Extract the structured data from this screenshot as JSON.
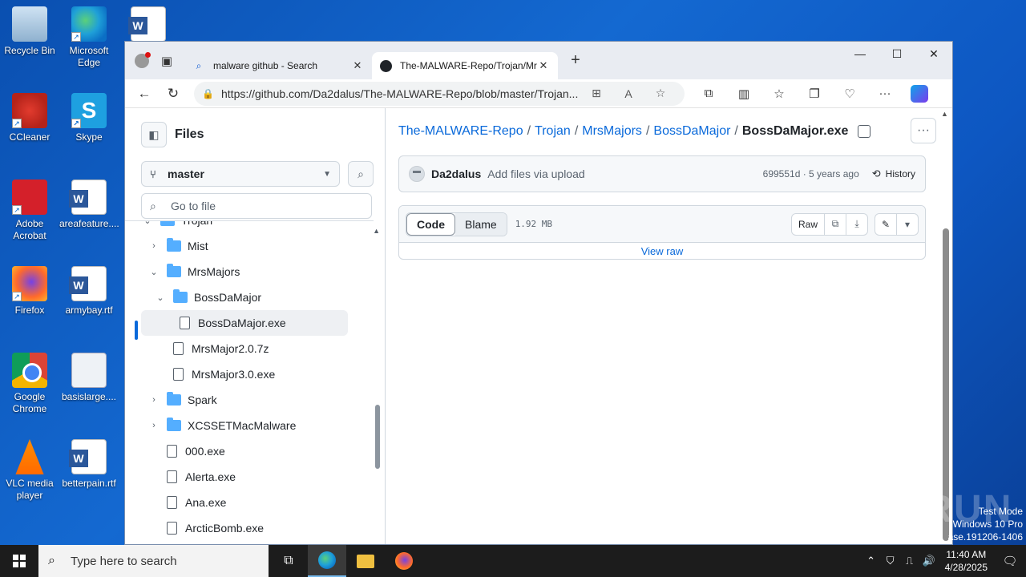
{
  "desktop": {
    "icons": [
      {
        "label": "Recycle Bin"
      },
      {
        "label": "Microsoft Edge"
      },
      {
        "label": "CCleaner"
      },
      {
        "label": "Skype"
      },
      {
        "label": "Adobe Acrobat"
      },
      {
        "label": "areafeature...."
      },
      {
        "label": "Firefox"
      },
      {
        "label": "armybay.rtf"
      },
      {
        "label": "Google Chrome"
      },
      {
        "label": "basislarge...."
      },
      {
        "label": "VLC media player"
      },
      {
        "label": "betterpain.rtf"
      }
    ],
    "watermark": "ANY.RUN",
    "test_mode": [
      "Test Mode",
      "Windows 10 Pro",
      "ase.191206-1406"
    ]
  },
  "browser": {
    "tabs": [
      {
        "title": "malware github - Search",
        "icon": "search-icon"
      },
      {
        "title": "The-MALWARE-Repo/Trojan/Mr:",
        "icon": "github-icon"
      }
    ],
    "url": "https://github.com/Da2dalus/The-MALWARE-Repo/blob/master/Trojan..."
  },
  "github": {
    "sidebar": {
      "title": "Files",
      "branch": "master",
      "goto_placeholder": "Go to file",
      "tree": [
        {
          "name": "Trojan",
          "type": "folder",
          "expanded": true,
          "level": 0
        },
        {
          "name": "Mist",
          "type": "folder",
          "expanded": false,
          "level": 1
        },
        {
          "name": "MrsMajors",
          "type": "folder",
          "expanded": true,
          "level": 1
        },
        {
          "name": "BossDaMajor",
          "type": "folder",
          "expanded": true,
          "level": 2
        },
        {
          "name": "BossDaMajor.exe",
          "type": "file",
          "level": 3,
          "selected": true
        },
        {
          "name": "MrsMajor2.0.7z",
          "type": "file",
          "level": 2
        },
        {
          "name": "MrsMajor3.0.exe",
          "type": "file",
          "level": 2
        },
        {
          "name": "Spark",
          "type": "folder",
          "expanded": false,
          "level": 1
        },
        {
          "name": "XCSSETMacMalware",
          "type": "folder",
          "expanded": false,
          "level": 1
        },
        {
          "name": "000.exe",
          "type": "file",
          "level": 1
        },
        {
          "name": "Alerta.exe",
          "type": "file",
          "level": 1
        },
        {
          "name": "Ana.exe",
          "type": "file",
          "level": 1
        },
        {
          "name": "ArcticBomb.exe",
          "type": "file",
          "level": 1
        }
      ]
    },
    "breadcrumb": {
      "parts": [
        "The-MALWARE-Repo",
        "Trojan",
        "MrsMajors",
        "BossDaMajor"
      ],
      "separator": "/",
      "current": "BossDaMajor.exe"
    },
    "commit": {
      "author": "Da2dalus",
      "message": "Add files via upload",
      "meta": "699551d · 5 years ago",
      "history_label": "History"
    },
    "file": {
      "code_label": "Code",
      "blame_label": "Blame",
      "size": "1.92 MB",
      "raw_label": "Raw",
      "view_raw": "View raw"
    }
  },
  "taskbar": {
    "search_placeholder": "Type here to search",
    "time": "11:40 AM",
    "date": "4/28/2025"
  }
}
